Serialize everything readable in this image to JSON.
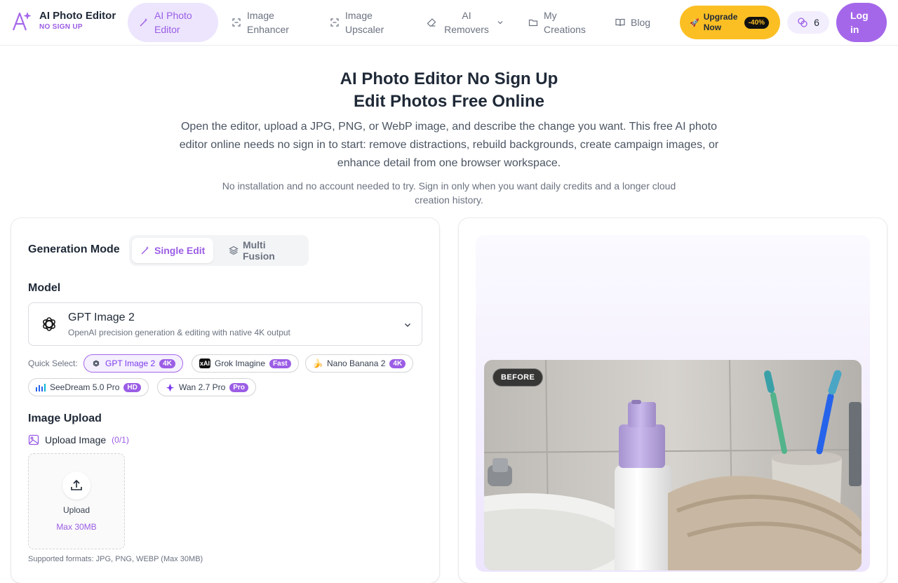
{
  "brand": {
    "title": "AI Photo Editor",
    "subtitle": "NO SIGN UP",
    "logo_icon": "sparkle-a-logo-icon"
  },
  "nav": {
    "items": [
      {
        "label": "AI Photo Editor",
        "icon": "magic-wand-icon",
        "active": true
      },
      {
        "label": "Image Enhancer",
        "icon": "scan-icon"
      },
      {
        "label": "Image Upscaler",
        "icon": "scan-icon"
      },
      {
        "label": "AI Removers",
        "icon": "eraser-icon",
        "has_dropdown": true
      },
      {
        "label": "My Creations",
        "icon": "folder-icon"
      },
      {
        "label": "Blog",
        "icon": "book-open-icon"
      }
    ],
    "upgrade_label": "Upgrade Now",
    "upgrade_badge": "-40%",
    "credits": "6",
    "login_label": "Log in"
  },
  "hero": {
    "title_line1": "AI Photo Editor No Sign Up",
    "title_line2": "Edit Photos Free Online",
    "description": "Open the editor, upload a JPG, PNG, or WebP image, and describe the change you want. This free AI photo editor online needs no sign in to start: remove distractions, rebuild backgrounds, create campaign images, or enhance detail from one browser workspace.",
    "note": "No installation and no account needed to try. Sign in only when you want daily credits and a longer cloud creation history."
  },
  "editor": {
    "generation_mode_label": "Generation Mode",
    "modes": [
      {
        "label": "Single Edit",
        "active": true
      },
      {
        "label": "Multi Fusion",
        "active": false
      }
    ],
    "model_label": "Model",
    "selected_model": {
      "name": "GPT Image 2",
      "description": "OpenAI precision generation & editing with native 4K output"
    },
    "quick_select_label": "Quick Select:",
    "quick_select": [
      {
        "name": "GPT Image 2",
        "tag": "4K",
        "selected": true
      },
      {
        "name": "Grok Imagine",
        "tag": "Fast"
      },
      {
        "name": "Nano Banana 2",
        "tag": "4K"
      },
      {
        "name": "SeeDream 5.0 Pro",
        "tag": "HD"
      },
      {
        "name": "Wan 2.7 Pro",
        "tag": "Pro"
      }
    ],
    "image_upload_label": "Image Upload",
    "upload_image_label": "Upload Image",
    "upload_count": "(0/1)",
    "upload_button": "Upload",
    "upload_limit": "Max 30MB",
    "supported_formats": "Supported formats: JPG, PNG, WEBP (Max 30MB)"
  },
  "preview": {
    "before_label": "BEFORE"
  },
  "colors": {
    "accent": "#9b5de5",
    "upgrade": "#fbbf24"
  }
}
